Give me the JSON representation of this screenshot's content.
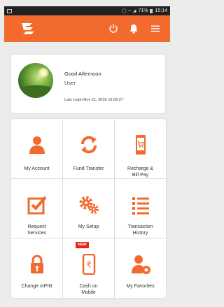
{
  "status_bar": {
    "battery": "71%",
    "time": "15:14"
  },
  "colors": {
    "brand": "#f26a2d",
    "status_bar": "#212121"
  },
  "app_bar": {
    "logo": "bank-logo",
    "actions": [
      "power-icon",
      "bell-icon",
      "menu-icon"
    ]
  },
  "profile": {
    "greeting": "Good Afternoon",
    "username": "User",
    "last_login": "Last Login:Nov 21, 2016 15:05:27"
  },
  "tiles": [
    {
      "label_1": "My Account",
      "label_2": "",
      "icon": "person-icon"
    },
    {
      "label_1": "Fund Transfer",
      "label_2": "",
      "icon": "refresh-arrows-icon"
    },
    {
      "label_1": "Recharge &",
      "label_2": "Bill Pay",
      "icon": "phone-cart-icon"
    },
    {
      "label_1": "Request",
      "label_2": "Services",
      "icon": "checkbox-pencil-icon"
    },
    {
      "label_1": "My Setup",
      "label_2": "",
      "icon": "gears-icon"
    },
    {
      "label_1": "Transaction",
      "label_2": "History",
      "icon": "list-icon"
    },
    {
      "label_1": "Change mPIN",
      "label_2": "",
      "icon": "lock-icon"
    },
    {
      "label_1": "Cash on",
      "label_2": "Mobile",
      "icon": "rupee-phone-icon",
      "badge": "NEW"
    },
    {
      "label_1": "My Favorites",
      "label_2": "",
      "icon": "person-star-icon"
    }
  ]
}
